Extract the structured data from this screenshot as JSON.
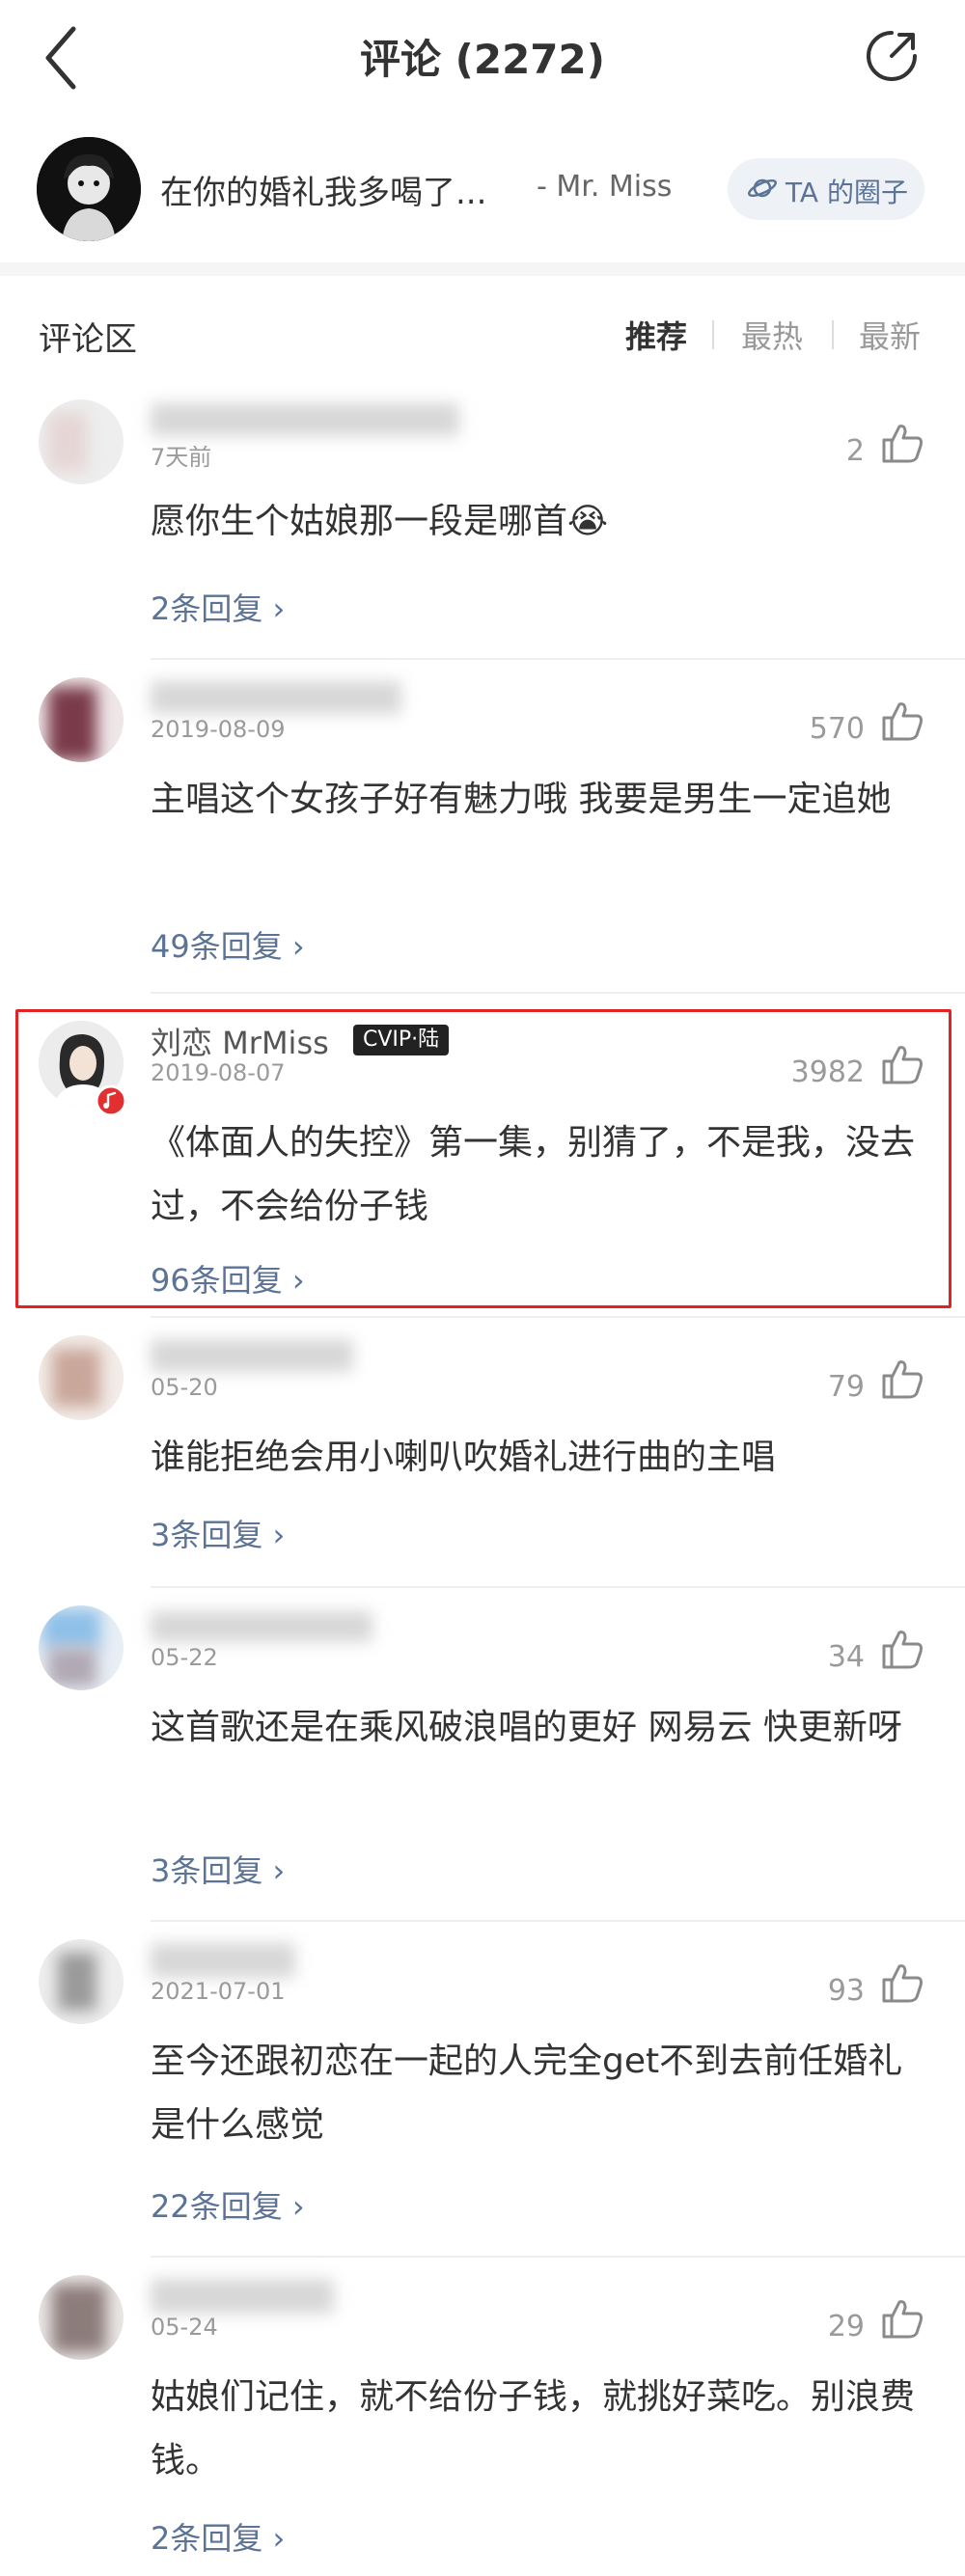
{
  "header": {
    "title": "评论 (2272)"
  },
  "song": {
    "title": "在你的婚礼我多喝了...",
    "artist": "- Mr. Miss",
    "circle_label": "TA 的圈子"
  },
  "section": {
    "title": "评论区",
    "tabs": [
      "推荐",
      "最热",
      "最新"
    ],
    "active_tab": "推荐"
  },
  "colors": {
    "accent": "#5b7396",
    "highlight": "#e02424",
    "badge": "#222222"
  },
  "comments": [
    {
      "name": "",
      "date": "7天前",
      "likes": "2",
      "text": "愿你生个姑娘那一段是哪首😭",
      "replies": "2条回复 ›"
    },
    {
      "name": "",
      "date": "2019-08-09",
      "likes": "570",
      "text": "主唱这个女孩子好有魅力哦 我要是男生一定追她",
      "replies": "49条回复 ›"
    },
    {
      "name": "刘恋 MrMiss",
      "badge": "CVIP·陆",
      "date": "2019-08-07",
      "likes": "3982",
      "text": "《体面人的失控》第一集，别猜了，不是我，没去过，不会给份子钱",
      "replies": "96条回复 ›"
    },
    {
      "name": "",
      "date": "05-20",
      "likes": "79",
      "text": "谁能拒绝会用小喇叭吹婚礼进行曲的主唱",
      "replies": "3条回复 ›"
    },
    {
      "name": "",
      "date": "05-22",
      "likes": "34",
      "text": "这首歌还是在乘风破浪唱的更好  网易云  快更新呀",
      "replies": "3条回复 ›"
    },
    {
      "name": "",
      "date": "2021-07-01",
      "likes": "93",
      "text": "至今还跟初恋在一起的人完全get不到去前任婚礼是什么感觉",
      "replies": "22条回复 ›"
    },
    {
      "name": "",
      "date": "05-24",
      "likes": "29",
      "text": "姑娘们记住，就不给份子钱，就挑好菜吃。别浪费钱。",
      "replies": "2条回复 ›"
    }
  ]
}
